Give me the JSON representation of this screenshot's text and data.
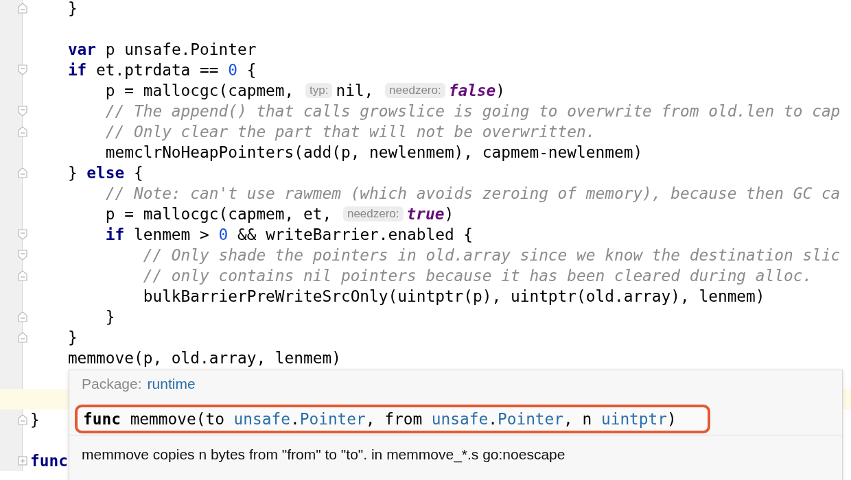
{
  "editor": {
    "lines": [
      {
        "kind": "fold-end",
        "segments": [
          {
            "kind": "plain",
            "text": "    }"
          }
        ]
      },
      {
        "kind": "plain"
      },
      {
        "kind": "plain",
        "segments": [
          {
            "kind": "keyword",
            "text": "    var"
          },
          {
            "kind": "plain",
            "text": " p unsafe.Pointer"
          }
        ]
      },
      {
        "kind": "fold-start",
        "segments": [
          {
            "kind": "keyword",
            "text": "    if"
          },
          {
            "kind": "plain",
            "text": " et.ptrdata == "
          },
          {
            "kind": "number",
            "text": "0"
          },
          {
            "kind": "plain",
            "text": " {"
          }
        ]
      },
      {
        "kind": "plain",
        "segments": [
          {
            "kind": "plain",
            "text": "        p = mallocgc(capmem, "
          },
          {
            "kind": "hint",
            "text": "typ:"
          },
          {
            "kind": "plain",
            "text": "nil, "
          },
          {
            "kind": "hint",
            "text": "needzero:"
          },
          {
            "kind": "bool",
            "text": "false"
          },
          {
            "kind": "plain",
            "text": ")"
          }
        ]
      },
      {
        "kind": "fold-start",
        "segments": [
          {
            "kind": "comment",
            "text": "        // The append() that calls growslice is going to overwrite from old.len to cap"
          }
        ]
      },
      {
        "kind": "fold-end",
        "segments": [
          {
            "kind": "comment",
            "text": "        // Only clear the part that will not be overwritten."
          }
        ]
      },
      {
        "kind": "plain",
        "segments": [
          {
            "kind": "plain",
            "text": "        memclrNoHeapPointers(add(p, newlenmem), capmem-newlenmem)"
          }
        ]
      },
      {
        "kind": "fold-end",
        "segments": [
          {
            "kind": "plain",
            "text": "    } "
          },
          {
            "kind": "keyword",
            "text": "else"
          },
          {
            "kind": "plain",
            "text": " {"
          }
        ]
      },
      {
        "kind": "plain",
        "segments": [
          {
            "kind": "comment",
            "text": "        // Note: can't use rawmem (which avoids zeroing of memory), because then GC ca"
          }
        ]
      },
      {
        "kind": "plain",
        "segments": [
          {
            "kind": "plain",
            "text": "        p = mallocgc(capmem, et, "
          },
          {
            "kind": "hint",
            "text": "needzero:"
          },
          {
            "kind": "bool",
            "text": "true"
          },
          {
            "kind": "plain",
            "text": ")"
          }
        ]
      },
      {
        "kind": "fold-start",
        "segments": [
          {
            "kind": "keyword",
            "text": "        if"
          },
          {
            "kind": "plain",
            "text": " lenmem > "
          },
          {
            "kind": "number",
            "text": "0"
          },
          {
            "kind": "plain",
            "text": " && writeBarrier.enabled {"
          }
        ]
      },
      {
        "kind": "fold-start",
        "segments": [
          {
            "kind": "comment",
            "text": "            // Only shade the pointers in old.array since we know the destination slic"
          }
        ]
      },
      {
        "kind": "fold-end",
        "segments": [
          {
            "kind": "comment",
            "text": "            // only contains nil pointers because it has been cleared during alloc."
          }
        ]
      },
      {
        "kind": "plain",
        "segments": [
          {
            "kind": "plain",
            "text": "            bulkBarrierPreWriteSrcOnly(uintptr(p), uintptr(old.array), lenmem)"
          }
        ]
      },
      {
        "kind": "fold-end",
        "segments": [
          {
            "kind": "plain",
            "text": "        }"
          }
        ]
      },
      {
        "kind": "fold-end",
        "segments": [
          {
            "kind": "plain",
            "text": "    }"
          }
        ]
      },
      {
        "kind": "plain",
        "segments": [
          {
            "kind": "plain",
            "text": "    memmove(p, old.array, lenmem)"
          }
        ]
      },
      {
        "kind": "plain"
      },
      {
        "kind": "plain",
        "current": true
      },
      {
        "kind": "fold-end",
        "segments": [
          {
            "kind": "plain",
            "text": "}"
          }
        ]
      },
      {
        "kind": "plain"
      },
      {
        "kind": "collapsed",
        "segments": [
          {
            "kind": "keyword",
            "text": "func"
          }
        ]
      }
    ]
  },
  "popup": {
    "package_label": "Package:",
    "package": "runtime",
    "signature": [
      {
        "kind": "keyword",
        "text": "func"
      },
      {
        "kind": "plain",
        "text": " memmove(to "
      },
      {
        "kind": "type",
        "text": "unsafe"
      },
      {
        "kind": "plain",
        "text": "."
      },
      {
        "kind": "type",
        "text": "Pointer"
      },
      {
        "kind": "plain",
        "text": ", from "
      },
      {
        "kind": "type",
        "text": "unsafe"
      },
      {
        "kind": "plain",
        "text": "."
      },
      {
        "kind": "type",
        "text": "Pointer"
      },
      {
        "kind": "plain",
        "text": ", n "
      },
      {
        "kind": "type",
        "text": "uintptr"
      },
      {
        "kind": "plain",
        "text": ")"
      }
    ],
    "description": "memmove copies n bytes from \"from\" to \"to\". in memmove_*.s go:noescape"
  }
}
